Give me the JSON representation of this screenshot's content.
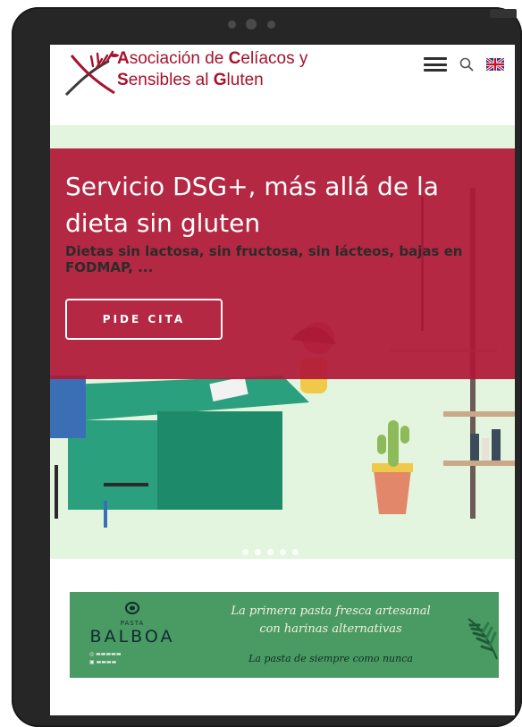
{
  "header": {
    "logo_line1_parts": [
      "A",
      "sociación de ",
      "C",
      "elíacos y"
    ],
    "logo_line2_parts": [
      "S",
      "ensibles al ",
      "G",
      "luten"
    ],
    "menu_icon": "hamburger-menu-icon",
    "search_icon": "search-icon",
    "language_icon": "uk-flag-icon"
  },
  "hero": {
    "title": "Servicio DSG+, más allá de la dieta sin gluten",
    "subtitle": "Dietas sin lactosa, sin fructosa, sin lácteos, bajas en FODMAP, ...",
    "cta_label": "PIDE CITA",
    "slide_count": 5
  },
  "banner": {
    "brand_small": "PASTA",
    "brand_name": "BALBOA",
    "line1": "La primera pasta fresca artesanal",
    "line2": "con harinas alternativas",
    "line3": "La pasta de siempre como nunca"
  },
  "colors": {
    "brand_red": "#a7122e",
    "hero_overlay": "#b01838",
    "hero_bg": "#e3f5df",
    "banner_green": "#4a9a63",
    "device_frame": "#262626"
  }
}
